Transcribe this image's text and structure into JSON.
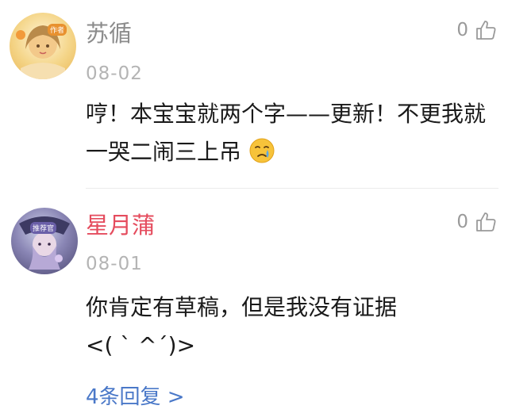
{
  "comments": [
    {
      "username": "苏循",
      "date": "08-02",
      "likes": "0",
      "text": "哼！本宝宝就两个字——更新！不更我就一哭二闹三上吊",
      "avatar_badge": "作者",
      "emoji": "crying-face-emoji"
    },
    {
      "username": "星月蒲",
      "date": "08-01",
      "likes": "0",
      "text_line1": "你肯定有草稿，但是我没有证据",
      "text_line2": "<( ` ^´)>",
      "avatar_badge": "推荐官",
      "replies_link": "4条回复 >"
    }
  ],
  "colors": {
    "username_muted": "#8c8c8c",
    "username_highlight": "#e54c5e",
    "link": "#4a78c8",
    "date": "#b4b4b4"
  }
}
